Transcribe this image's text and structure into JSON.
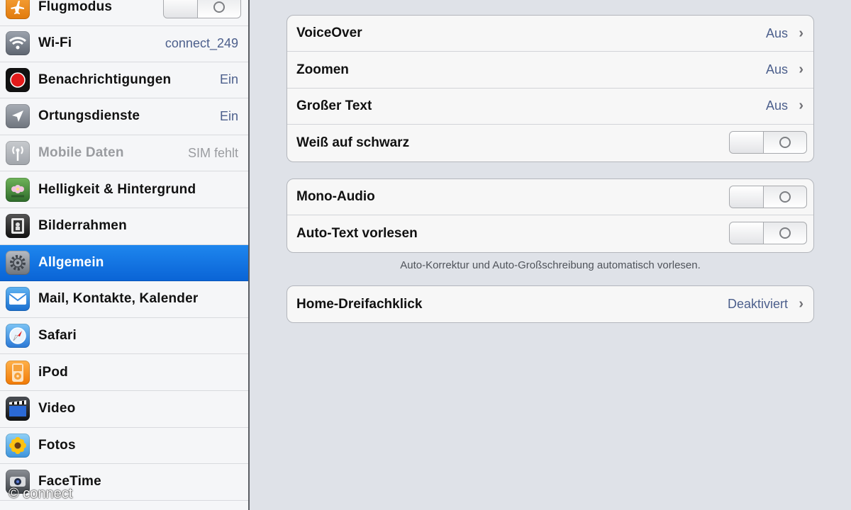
{
  "sidebar": {
    "items": [
      {
        "label": "Flugmodus",
        "value": "",
        "icon": "airplane-icon",
        "toggle": "off"
      },
      {
        "label": "Wi-Fi",
        "value": "connect_249",
        "icon": "wifi-icon"
      },
      {
        "label": "Benachrichtigungen",
        "value": "Ein",
        "icon": "notifications-icon"
      },
      {
        "label": "Ortungsdienste",
        "value": "Ein",
        "icon": "location-arrow-icon"
      },
      {
        "label": "Mobile Daten",
        "value": "SIM fehlt",
        "icon": "cellular-antenna-icon",
        "disabled": true
      },
      {
        "label": "Helligkeit & Hintergrund",
        "value": "",
        "icon": "flower-wallpaper-icon"
      },
      {
        "label": "Bilderrahmen",
        "value": "",
        "icon": "picture-frame-icon"
      },
      {
        "label": "Allgemein",
        "value": "",
        "icon": "gear-icon",
        "selected": true
      },
      {
        "label": "Mail, Kontakte, Kalender",
        "value": "",
        "icon": "mail-envelope-icon"
      },
      {
        "label": "Safari",
        "value": "",
        "icon": "safari-compass-icon"
      },
      {
        "label": "iPod",
        "value": "",
        "icon": "ipod-icon"
      },
      {
        "label": "Video",
        "value": "",
        "icon": "clapperboard-icon"
      },
      {
        "label": "Fotos",
        "value": "",
        "icon": "sunflower-icon"
      },
      {
        "label": "FaceTime",
        "value": "",
        "icon": "facetime-camera-icon"
      }
    ]
  },
  "main": {
    "group1": [
      {
        "label": "VoiceOver",
        "value": "Aus",
        "type": "disclosure"
      },
      {
        "label": "Zoomen",
        "value": "Aus",
        "type": "disclosure"
      },
      {
        "label": "Großer Text",
        "value": "Aus",
        "type": "disclosure"
      },
      {
        "label": "Weiß auf schwarz",
        "type": "toggle",
        "toggle": "off"
      }
    ],
    "group2": [
      {
        "label": "Mono-Audio",
        "type": "toggle",
        "toggle": "off"
      },
      {
        "label": "Auto-Text vorlesen",
        "type": "toggle",
        "toggle": "off"
      }
    ],
    "group2_footer": "Auto-Korrektur und Auto-Großschreibung automatisch vorlesen.",
    "group3": [
      {
        "label": "Home-Dreifachklick",
        "value": "Deaktiviert",
        "type": "disclosure"
      }
    ],
    "chevron": "›",
    "toggle_off_glyph": "O"
  },
  "watermark": "© connect",
  "colors": {
    "accent": "#0a64d6",
    "value_text": "#4c5f8c",
    "background": "#dfe2e8"
  }
}
